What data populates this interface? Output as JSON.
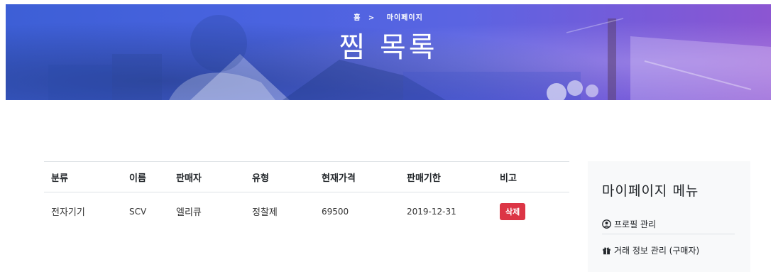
{
  "hero": {
    "breadcrumb_home": "홈",
    "breadcrumb_separator": ">",
    "breadcrumb_current": "마이페이지",
    "title": "찜 목록"
  },
  "table": {
    "headers": [
      "분류",
      "이름",
      "판매자",
      "유형",
      "현재가격",
      "판매기한",
      "비고"
    ],
    "rows": [
      {
        "category": "전자기기",
        "name": "SCV",
        "seller": "엘리큐",
        "type": "정찰제",
        "price": "69500",
        "deadline": "2019-12-31",
        "action_label": "삭제"
      }
    ]
  },
  "sidebar": {
    "title": "마이페이지 메뉴",
    "items": [
      {
        "label": "프로필 관리",
        "icon": "user-circle-icon"
      },
      {
        "label": "거래 정보 관리 (구매자)",
        "icon": "gift-icon"
      }
    ]
  },
  "colors": {
    "hero_gradient_start": "#3d5fd6",
    "hero_gradient_end": "#8c56d2",
    "delete_button": "#dc3545",
    "sidebar_background": "#f8f9fa"
  }
}
